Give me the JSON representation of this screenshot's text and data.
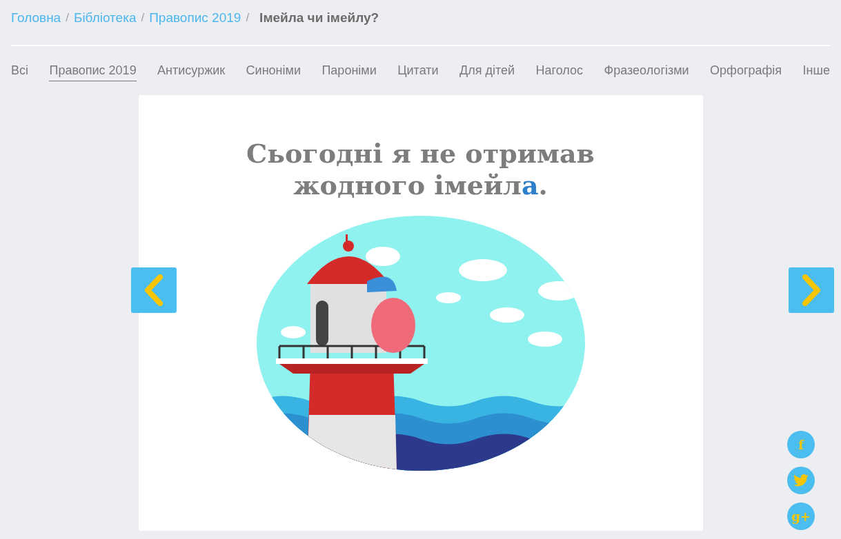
{
  "breadcrumbs": [
    {
      "label": "Головна",
      "current": false
    },
    {
      "label": "Бібліотека",
      "current": false
    },
    {
      "label": "Правопис 2019",
      "current": false
    },
    {
      "label": "Імейла чи імейлу?",
      "current": true
    }
  ],
  "breadcrumb_separator": "/",
  "tabs": [
    {
      "label": "Всі",
      "selected": false
    },
    {
      "label": "Правопис 2019",
      "selected": true
    },
    {
      "label": "Антисуржик",
      "selected": false
    },
    {
      "label": "Синоніми",
      "selected": false
    },
    {
      "label": "Пароніми",
      "selected": false
    },
    {
      "label": "Цитати",
      "selected": false
    },
    {
      "label": "Для дітей",
      "selected": false
    },
    {
      "label": "Наголос",
      "selected": false
    },
    {
      "label": "Фразеологізми",
      "selected": false
    },
    {
      "label": "Орфографія",
      "selected": false
    },
    {
      "label": "Інше",
      "selected": false
    }
  ],
  "card": {
    "caption_line_1": "Сьогодні я не отримав",
    "caption_line_2": "жодного імейл**а**."
  },
  "social": [
    {
      "kind": "facebook",
      "label": "f"
    },
    {
      "kind": "twitter"
    },
    {
      "kind": "googleplus",
      "label": "g+"
    }
  ]
}
